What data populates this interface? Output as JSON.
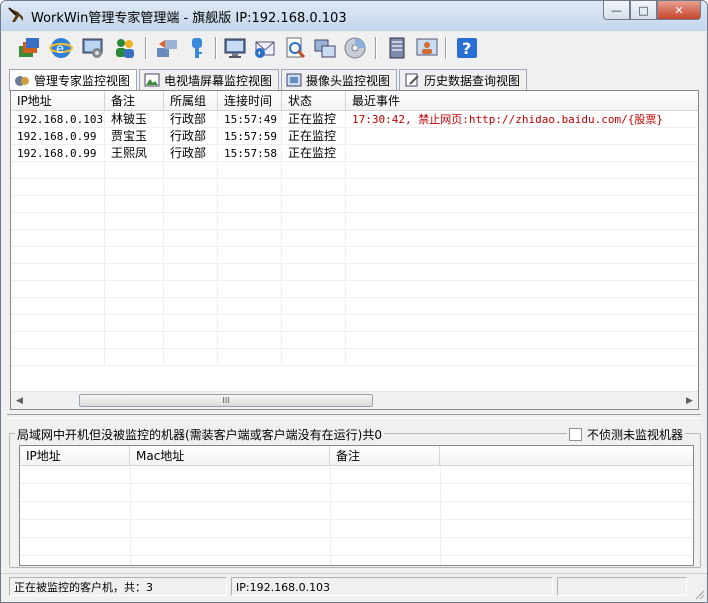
{
  "window": {
    "title": "WorkWin管理专家管理端 - 旗舰版 IP:192.168.0.103",
    "buttons": {
      "minimize": "—",
      "maximize": "□",
      "close": "✕"
    }
  },
  "toolbar": {
    "icons": [
      "monitor-layers-icon",
      "ie-globe-icon",
      "screen-settings-icon",
      "users-group-icon",
      "network-transfer-icon",
      "key-icon",
      "remote-desktop-icon",
      "email-icon",
      "search-document-icon",
      "window-copy-icon",
      "disc-icon",
      "server-icon",
      "user-report-icon",
      "help-icon"
    ]
  },
  "tabs": [
    {
      "label": "管理专家监控视图",
      "active": true
    },
    {
      "label": "电视墙屏幕监控视图",
      "active": false
    },
    {
      "label": "摄像头监控视图",
      "active": false
    },
    {
      "label": "历史数据查询视图",
      "active": false
    }
  ],
  "client_list": {
    "columns": [
      "IP地址",
      "备注",
      "所属组",
      "连接时间",
      "状态",
      "最近事件"
    ],
    "rows": [
      {
        "ip": "192.168.0.103",
        "note": "林铍玉",
        "group": "行政部",
        "time": "15:57:49",
        "status": "正在监控",
        "event": "17:30:42, 禁止网页:http://zhidao.baidu.com/{股票}"
      },
      {
        "ip": "192.168.0.99",
        "note": "贾宝玉",
        "group": "行政部",
        "time": "15:57:59",
        "status": "正在监控",
        "event": ""
      },
      {
        "ip": "192.168.0.99",
        "note": "王熙凤",
        "group": "行政部",
        "time": "15:57:58",
        "status": "正在监控",
        "event": ""
      }
    ],
    "scroll_grip": "III"
  },
  "unmonitored": {
    "title": "局域网中开机但没被监控的机器(需装客户端或客户端没有在运行)共0",
    "checkbox_label": "不侦测未监视机器",
    "checkbox_checked": false,
    "columns": [
      "IP地址",
      "Mac地址",
      "备注"
    ]
  },
  "statusbar": {
    "clients": "正在被监控的客户机，共：3",
    "ip": "IP:192.168.0.103",
    "extra": ""
  },
  "colors": {
    "event_text": "#c00000",
    "accent": "#3a6fc4"
  }
}
